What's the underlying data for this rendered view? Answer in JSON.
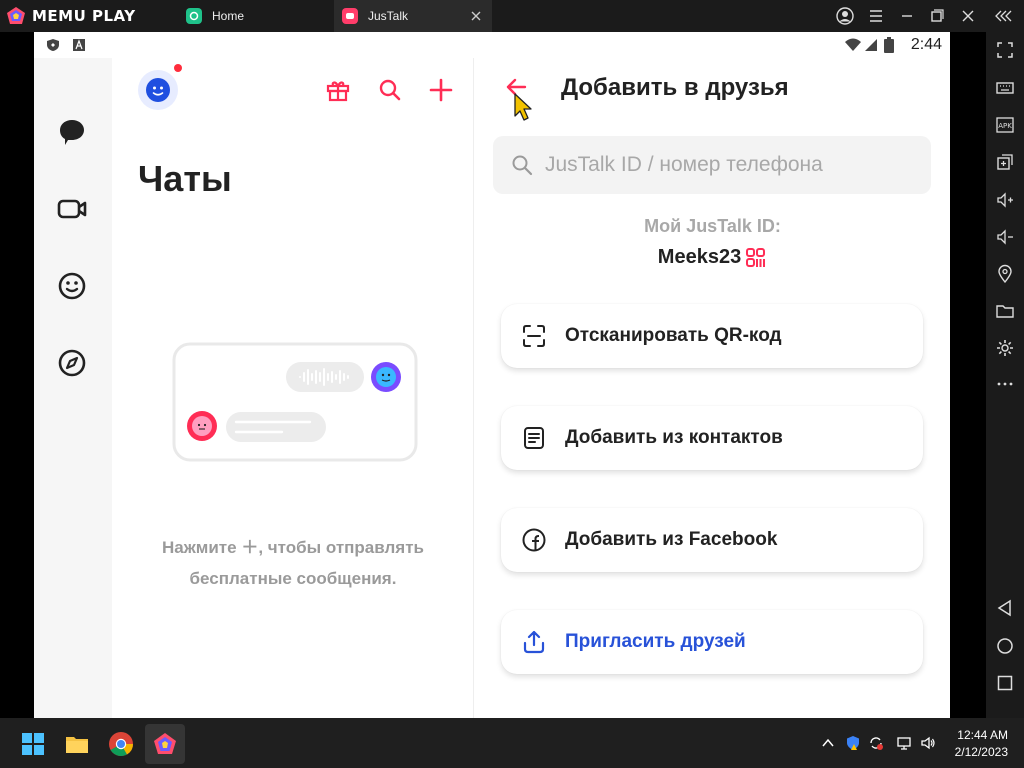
{
  "emulator": {
    "brand": "MEMU PLAY",
    "tabs": [
      {
        "label": "Home"
      },
      {
        "label": "JusTalk"
      }
    ]
  },
  "statusbar": {
    "time": "2:44"
  },
  "chats": {
    "title": "Чаты",
    "empty_line1": "Нажмите ＋, чтобы отправлять",
    "empty_line2": "бесплатные сообщения."
  },
  "add_friends": {
    "title": "Добавить в друзья",
    "search_placeholder": "JusTalk ID / номер телефона",
    "my_id_label": "Мой JusTalk ID:",
    "my_id_value": "Meeks23",
    "actions": [
      {
        "label": "Отсканировать QR-код",
        "icon": "qr-scan-icon"
      },
      {
        "label": "Добавить из контактов",
        "icon": "contacts-icon"
      },
      {
        "label": "Добавить из Facebook",
        "icon": "facebook-icon"
      },
      {
        "label": "Пригласить друзей",
        "icon": "share-icon"
      }
    ]
  },
  "taskbar": {
    "time": "12:44 AM",
    "date": "2/12/2023"
  },
  "colors": {
    "accent_red": "#ff2d55",
    "accent_blue": "#2852d8",
    "emulator_bg": "#1b1b1b"
  }
}
